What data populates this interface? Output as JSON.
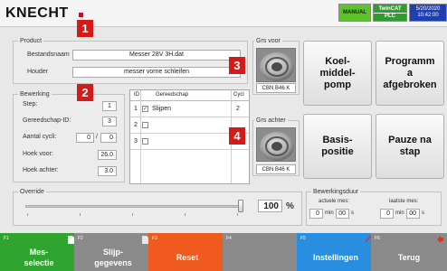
{
  "header": {
    "logo_text": "KNECHT",
    "mode_badge": "MANUAL",
    "twincat_label": "TwinCAT",
    "plc_label": "PLC",
    "date": "5/20/2020",
    "time": "10:42:00"
  },
  "product": {
    "title": "Product",
    "file_label": "Bestandsnaam",
    "file_value": "Messer 28V 3H.dat",
    "holder_label": "Houder",
    "holder_value": "messer vorne schleifen"
  },
  "bewerking": {
    "title": "Bewerking",
    "step_label": "Step:",
    "step_value": "1",
    "tool_id_label": "Gereedschap-ID:",
    "tool_id_value": "3",
    "cycles_label": "Aantal cycli:",
    "cycles_done": "0",
    "cycles_total": "0",
    "angle_front_label": "Hoek voor:",
    "angle_front_value": "26.0",
    "angle_back_label": "Hoek achter:",
    "angle_back_value": "3.0"
  },
  "tool_table": {
    "headers": [
      "ID",
      "Gereedschap",
      "Cycl"
    ],
    "rows": [
      {
        "id": "1",
        "checked": "✓",
        "name": "Slijpen",
        "cycles": "2"
      },
      {
        "id": "2",
        "checked": "",
        "name": "",
        "cycles": ""
      },
      {
        "id": "3",
        "checked": "",
        "name": "",
        "cycles": ""
      }
    ]
  },
  "wheels": {
    "front_title": "Grs voor",
    "front_caption": "CBN B46 K",
    "back_title": "Grs achter",
    "back_caption": "CBN B46 K"
  },
  "buttons": {
    "coolant": "Koel-\nmiddel-\npomp",
    "program_abort": "Programm\na\nafgebroken",
    "home": "Basis-\npositie",
    "pause_step": "Pauze na\nstap"
  },
  "override": {
    "title": "Override",
    "value": "100",
    "unit": "%"
  },
  "duration": {
    "title": "Bewerkingsduur",
    "current_label": "actuele mes:",
    "current_min": "0",
    "current_sec": "00",
    "last_label": "laatste mes:",
    "last_min": "0",
    "last_sec": "00",
    "min_unit": "min",
    "sec_unit": "s"
  },
  "markers": [
    "1",
    "2",
    "3",
    "4"
  ],
  "function_keys": [
    {
      "num": "F1",
      "label": "Mes-\nselectie",
      "color": "#2fa52f"
    },
    {
      "num": "F2",
      "label": "Slijp-\ngegevens",
      "color": "#8a8a8a"
    },
    {
      "num": "F3",
      "label": "Reset",
      "color": "#f05a1e"
    },
    {
      "num": "F4",
      "label": "",
      "color": "#8a8a8a"
    },
    {
      "num": "F5",
      "label": "Instellingen",
      "color": "#2a8ee0"
    },
    {
      "num": "F6",
      "label": "Terug",
      "color": "#8a8a8a"
    }
  ],
  "colors": {
    "manual_badge": "#5cc42b",
    "twincat_badge": "#2e9c2e",
    "datetime_badge": "#1e3fb0",
    "marker": "#d51a1a"
  }
}
